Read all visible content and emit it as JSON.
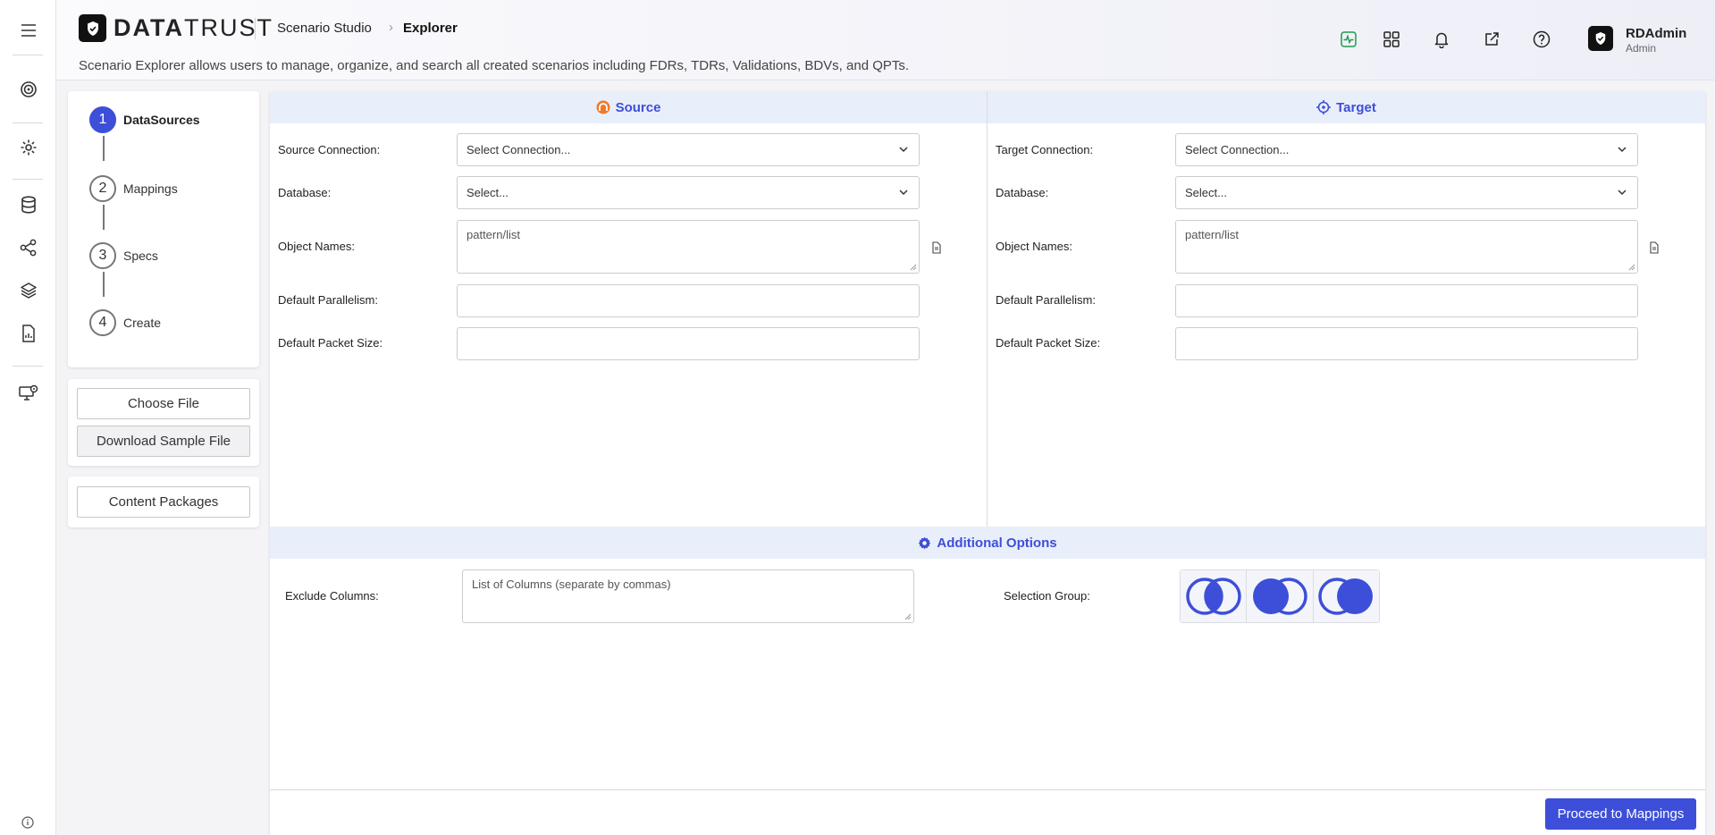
{
  "app": {
    "logo_bold": "DATA",
    "logo_light": "TRUST",
    "breadcrumb": [
      "Scenario Studio",
      "Explorer"
    ],
    "subtitle": "Scenario Explorer allows users to manage, organize, and search all created scenarios including FDRs, TDRs, Validations, BDVs, and QPTs."
  },
  "user": {
    "name": "RDAdmin",
    "role": "Admin"
  },
  "steps": [
    {
      "num": "1",
      "label": "DataSources"
    },
    {
      "num": "2",
      "label": "Mappings"
    },
    {
      "num": "3",
      "label": "Specs"
    },
    {
      "num": "4",
      "label": "Create"
    }
  ],
  "file_buttons": {
    "choose": "Choose File",
    "download": "Download Sample File"
  },
  "content_packages": "Content Packages",
  "source": {
    "title": "Source",
    "connection_label": "Source Connection:",
    "connection_value": "Select Connection...",
    "database_label": "Database:",
    "database_value": "Select...",
    "objects_label": "Object Names:",
    "objects_placeholder": "pattern/list",
    "parallelism_label": "Default Parallelism:",
    "packet_label": "Default Packet Size:"
  },
  "target": {
    "title": "Target",
    "connection_label": "Target Connection:",
    "connection_value": "Select Connection...",
    "database_label": "Database:",
    "database_value": "Select...",
    "objects_label": "Object Names:",
    "objects_placeholder": "pattern/list",
    "parallelism_label": "Default Parallelism:",
    "packet_label": "Default Packet Size:"
  },
  "additional": {
    "title": "Additional Options",
    "exclude_label": "Exclude Columns:",
    "exclude_placeholder": "List of Columns (separate by commas)",
    "selection_label": "Selection Group:"
  },
  "proceed_label": "Proceed to Mappings",
  "colors": {
    "accent": "#3d4fd8",
    "source_icon": "#f07a2a",
    "activity_icon": "#1f9a4a"
  }
}
